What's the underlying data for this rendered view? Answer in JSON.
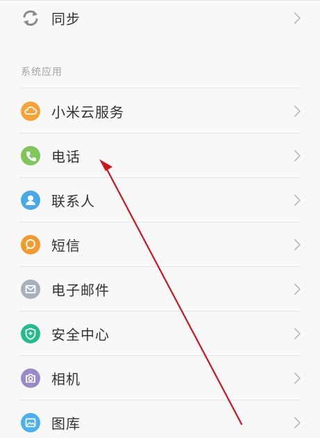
{
  "sync": {
    "label": "同步",
    "icon": "sync-icon"
  },
  "section": {
    "title": "系统应用"
  },
  "apps": [
    {
      "label": "小米云服务",
      "icon": "cloud-icon",
      "color": "#f7a33a"
    },
    {
      "label": "电话",
      "icon": "phone-icon",
      "color": "#7fc65b"
    },
    {
      "label": "联系人",
      "icon": "contact-icon",
      "color": "#48a8e8"
    },
    {
      "label": "短信",
      "icon": "message-icon",
      "color": "#f6992d"
    },
    {
      "label": "电子邮件",
      "icon": "mail-icon",
      "color": "#a7b1bb"
    },
    {
      "label": "安全中心",
      "icon": "shield-icon",
      "color": "#23bd8c"
    },
    {
      "label": "相机",
      "icon": "camera-icon",
      "color": "#9a88c8"
    },
    {
      "label": "图库",
      "icon": "gallery-icon",
      "color": "#4cb0ec"
    }
  ],
  "annotation": {
    "color": "#d0131b"
  }
}
